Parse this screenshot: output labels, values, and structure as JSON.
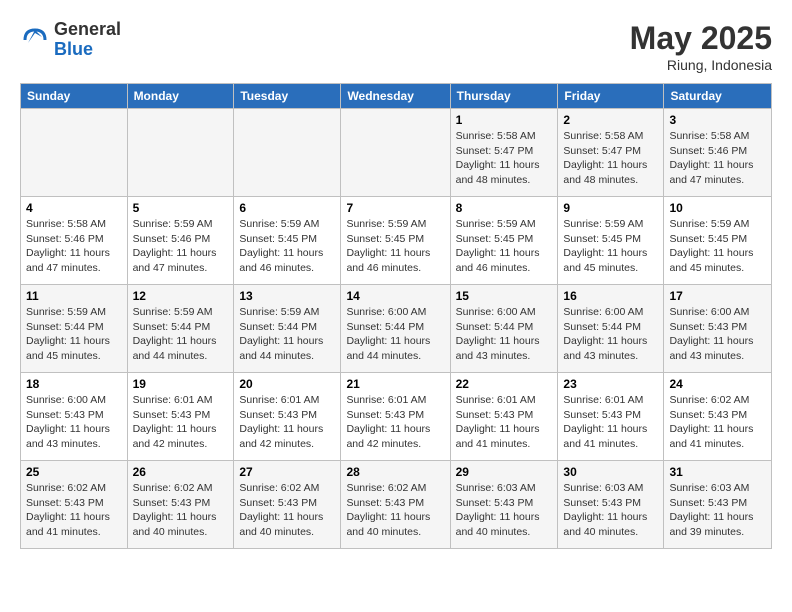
{
  "header": {
    "logo_general": "General",
    "logo_blue": "Blue",
    "month_year": "May 2025",
    "location": "Riung, Indonesia"
  },
  "days_of_week": [
    "Sunday",
    "Monday",
    "Tuesday",
    "Wednesday",
    "Thursday",
    "Friday",
    "Saturday"
  ],
  "weeks": [
    {
      "days": [
        {
          "num": "",
          "info": ""
        },
        {
          "num": "",
          "info": ""
        },
        {
          "num": "",
          "info": ""
        },
        {
          "num": "",
          "info": ""
        },
        {
          "num": "1",
          "info": "Sunrise: 5:58 AM\nSunset: 5:47 PM\nDaylight: 11 hours\nand 48 minutes."
        },
        {
          "num": "2",
          "info": "Sunrise: 5:58 AM\nSunset: 5:47 PM\nDaylight: 11 hours\nand 48 minutes."
        },
        {
          "num": "3",
          "info": "Sunrise: 5:58 AM\nSunset: 5:46 PM\nDaylight: 11 hours\nand 47 minutes."
        }
      ]
    },
    {
      "days": [
        {
          "num": "4",
          "info": "Sunrise: 5:58 AM\nSunset: 5:46 PM\nDaylight: 11 hours\nand 47 minutes."
        },
        {
          "num": "5",
          "info": "Sunrise: 5:59 AM\nSunset: 5:46 PM\nDaylight: 11 hours\nand 47 minutes."
        },
        {
          "num": "6",
          "info": "Sunrise: 5:59 AM\nSunset: 5:45 PM\nDaylight: 11 hours\nand 46 minutes."
        },
        {
          "num": "7",
          "info": "Sunrise: 5:59 AM\nSunset: 5:45 PM\nDaylight: 11 hours\nand 46 minutes."
        },
        {
          "num": "8",
          "info": "Sunrise: 5:59 AM\nSunset: 5:45 PM\nDaylight: 11 hours\nand 46 minutes."
        },
        {
          "num": "9",
          "info": "Sunrise: 5:59 AM\nSunset: 5:45 PM\nDaylight: 11 hours\nand 45 minutes."
        },
        {
          "num": "10",
          "info": "Sunrise: 5:59 AM\nSunset: 5:45 PM\nDaylight: 11 hours\nand 45 minutes."
        }
      ]
    },
    {
      "days": [
        {
          "num": "11",
          "info": "Sunrise: 5:59 AM\nSunset: 5:44 PM\nDaylight: 11 hours\nand 45 minutes."
        },
        {
          "num": "12",
          "info": "Sunrise: 5:59 AM\nSunset: 5:44 PM\nDaylight: 11 hours\nand 44 minutes."
        },
        {
          "num": "13",
          "info": "Sunrise: 5:59 AM\nSunset: 5:44 PM\nDaylight: 11 hours\nand 44 minutes."
        },
        {
          "num": "14",
          "info": "Sunrise: 6:00 AM\nSunset: 5:44 PM\nDaylight: 11 hours\nand 44 minutes."
        },
        {
          "num": "15",
          "info": "Sunrise: 6:00 AM\nSunset: 5:44 PM\nDaylight: 11 hours\nand 43 minutes."
        },
        {
          "num": "16",
          "info": "Sunrise: 6:00 AM\nSunset: 5:44 PM\nDaylight: 11 hours\nand 43 minutes."
        },
        {
          "num": "17",
          "info": "Sunrise: 6:00 AM\nSunset: 5:43 PM\nDaylight: 11 hours\nand 43 minutes."
        }
      ]
    },
    {
      "days": [
        {
          "num": "18",
          "info": "Sunrise: 6:00 AM\nSunset: 5:43 PM\nDaylight: 11 hours\nand 43 minutes."
        },
        {
          "num": "19",
          "info": "Sunrise: 6:01 AM\nSunset: 5:43 PM\nDaylight: 11 hours\nand 42 minutes."
        },
        {
          "num": "20",
          "info": "Sunrise: 6:01 AM\nSunset: 5:43 PM\nDaylight: 11 hours\nand 42 minutes."
        },
        {
          "num": "21",
          "info": "Sunrise: 6:01 AM\nSunset: 5:43 PM\nDaylight: 11 hours\nand 42 minutes."
        },
        {
          "num": "22",
          "info": "Sunrise: 6:01 AM\nSunset: 5:43 PM\nDaylight: 11 hours\nand 41 minutes."
        },
        {
          "num": "23",
          "info": "Sunrise: 6:01 AM\nSunset: 5:43 PM\nDaylight: 11 hours\nand 41 minutes."
        },
        {
          "num": "24",
          "info": "Sunrise: 6:02 AM\nSunset: 5:43 PM\nDaylight: 11 hours\nand 41 minutes."
        }
      ]
    },
    {
      "days": [
        {
          "num": "25",
          "info": "Sunrise: 6:02 AM\nSunset: 5:43 PM\nDaylight: 11 hours\nand 41 minutes."
        },
        {
          "num": "26",
          "info": "Sunrise: 6:02 AM\nSunset: 5:43 PM\nDaylight: 11 hours\nand 40 minutes."
        },
        {
          "num": "27",
          "info": "Sunrise: 6:02 AM\nSunset: 5:43 PM\nDaylight: 11 hours\nand 40 minutes."
        },
        {
          "num": "28",
          "info": "Sunrise: 6:02 AM\nSunset: 5:43 PM\nDaylight: 11 hours\nand 40 minutes."
        },
        {
          "num": "29",
          "info": "Sunrise: 6:03 AM\nSunset: 5:43 PM\nDaylight: 11 hours\nand 40 minutes."
        },
        {
          "num": "30",
          "info": "Sunrise: 6:03 AM\nSunset: 5:43 PM\nDaylight: 11 hours\nand 40 minutes."
        },
        {
          "num": "31",
          "info": "Sunrise: 6:03 AM\nSunset: 5:43 PM\nDaylight: 11 hours\nand 39 minutes."
        }
      ]
    }
  ]
}
